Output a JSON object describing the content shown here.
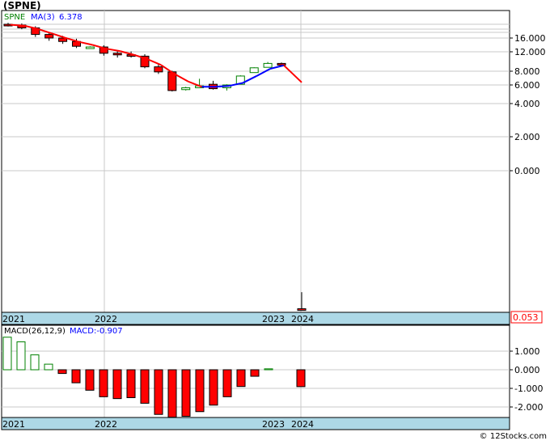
{
  "title": "(SPNE)",
  "footer": "© 12Stocks.com",
  "colors": {
    "up": "#008000",
    "down": "#ff0000",
    "ma_up": "#0000ff",
    "ma_down": "#ff0000",
    "axis_bar": "#add8e6"
  },
  "chart_data": [
    {
      "type": "candlestick",
      "legend": {
        "symbol": "SPNE",
        "ma_label": "MA(3)",
        "ma_value": "6.378"
      },
      "y_tick_labels": [
        "16.000",
        "12.000",
        "8.000",
        "6.000",
        "4.000",
        "2.000",
        "0.000"
      ],
      "y_tick_values": [
        16,
        12,
        8,
        6,
        4,
        2,
        0
      ],
      "x_labels": [
        "2021",
        "2022",
        "2023",
        "2024"
      ],
      "last_value_label": "0.053",
      "candles": [
        {
          "o": 21.0,
          "h": 21.5,
          "l": 20.2,
          "c": 20.7
        },
        {
          "o": 20.7,
          "h": 21.3,
          "l": 19.2,
          "c": 19.7
        },
        {
          "o": 19.7,
          "h": 20.3,
          "l": 16.4,
          "c": 17.3
        },
        {
          "o": 17.3,
          "h": 18.0,
          "l": 15.2,
          "c": 16.0
        },
        {
          "o": 16.0,
          "h": 16.8,
          "l": 14.3,
          "c": 15.0
        },
        {
          "o": 15.0,
          "h": 15.8,
          "l": 13.1,
          "c": 13.6
        },
        {
          "o": 13.3,
          "h": 13.6,
          "l": 13.0,
          "c": 13.4
        },
        {
          "o": 13.4,
          "h": 13.9,
          "l": 11.2,
          "c": 11.7
        },
        {
          "o": 11.7,
          "h": 12.4,
          "l": 10.8,
          "c": 11.4
        },
        {
          "o": 11.4,
          "h": 12.1,
          "l": 10.8,
          "c": 11.1
        },
        {
          "o": 11.1,
          "h": 11.5,
          "l": 8.6,
          "c": 8.9
        },
        {
          "o": 8.9,
          "h": 9.4,
          "l": 7.6,
          "c": 7.9
        },
        {
          "o": 7.9,
          "h": 8.1,
          "l": 5.3,
          "c": 5.4
        },
        {
          "o": 5.5,
          "h": 5.8,
          "l": 5.4,
          "c": 5.7
        },
        {
          "o": 5.7,
          "h": 6.9,
          "l": 5.7,
          "c": 5.9
        },
        {
          "o": 6.1,
          "h": 6.6,
          "l": 5.5,
          "c": 5.6
        },
        {
          "o": 5.7,
          "h": 6.1,
          "l": 5.4,
          "c": 6.0
        },
        {
          "o": 6.1,
          "h": 7.4,
          "l": 6.1,
          "c": 7.3
        },
        {
          "o": 7.8,
          "h": 8.8,
          "l": 7.8,
          "c": 8.7
        },
        {
          "o": 8.8,
          "h": 9.9,
          "l": 8.8,
          "c": 9.6
        },
        {
          "o": 9.6,
          "h": 9.8,
          "l": 9.2,
          "c": 9.3
        },
        {
          "o": 0.06,
          "h": 0.4,
          "l": 0.03,
          "c": 0.053
        }
      ],
      "ma": [
        20.8,
        20.5,
        19.3,
        17.7,
        16.1,
        14.9,
        14.0,
        12.9,
        12.2,
        11.4,
        10.5,
        9.3,
        7.6,
        6.5,
        5.8,
        5.8,
        5.9,
        6.3,
        7.3,
        8.5,
        9.2,
        6.378
      ]
    },
    {
      "type": "bar",
      "legend": {
        "label": "MACD(26,12,9)",
        "value_label": "MACD:-0.907"
      },
      "y_tick_labels": [
        "1.000",
        "0.000",
        "-1.000",
        "-2.000"
      ],
      "y_tick_values": [
        1,
        0,
        -1,
        -2
      ],
      "x_labels": [
        "2021",
        "2022",
        "2023",
        "2024"
      ],
      "values": [
        1.75,
        1.5,
        0.8,
        0.3,
        -0.2,
        -0.7,
        -1.1,
        -1.45,
        -1.55,
        -1.5,
        -1.8,
        -2.4,
        -2.55,
        -2.5,
        -2.25,
        -1.9,
        -1.45,
        -0.9,
        -0.35,
        0.05,
        -0.907
      ]
    }
  ]
}
